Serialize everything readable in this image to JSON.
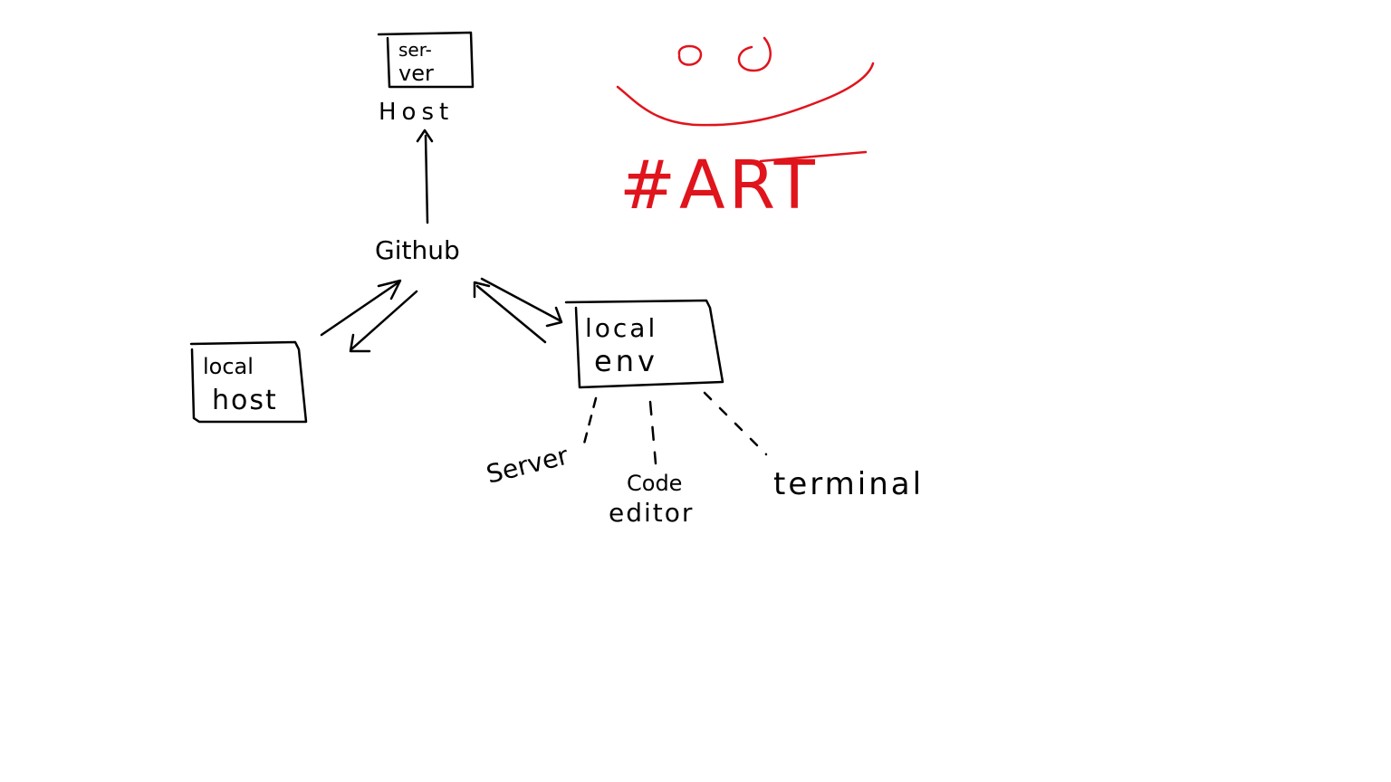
{
  "colors": {
    "background": "#ffffff",
    "ink": "#000000",
    "accent": "#e0141c"
  },
  "nodes": {
    "server": {
      "label_line1": "ser-",
      "label_line2": "ver",
      "caption": "Host"
    },
    "github": {
      "label": "Github"
    },
    "localhost": {
      "label_line1": "local",
      "label_line2": "host"
    },
    "localenv": {
      "label_line1": "local",
      "label_line2": "env"
    }
  },
  "components": {
    "server": {
      "label": "Server"
    },
    "code_editor": {
      "label_line1": "Code",
      "label_line2": "editor"
    },
    "terminal": {
      "label": "terminal"
    }
  },
  "art": {
    "label": "#ART"
  }
}
